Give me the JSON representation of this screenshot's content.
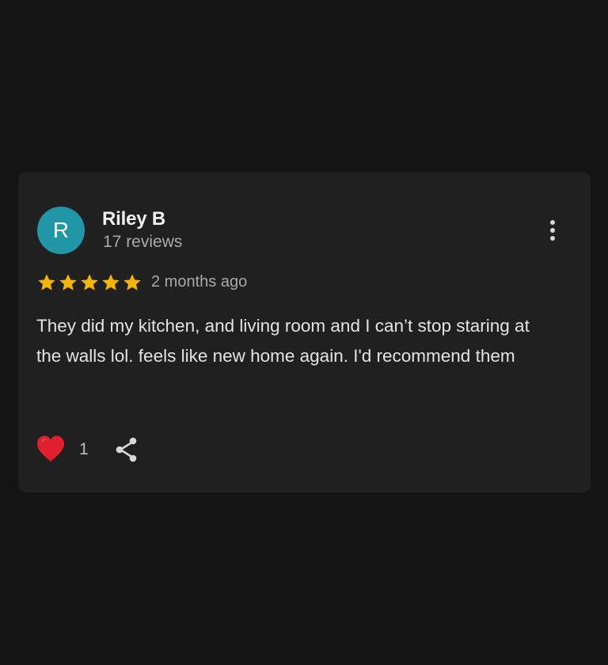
{
  "review": {
    "author_initial": "R",
    "author_name": "Riley B",
    "review_count": "17 reviews",
    "rating": 5,
    "rating_max": 5,
    "date": "2 months ago",
    "text": "They did my kitchen, and living room and I can’t stop staring at the walls lol. feels like new home again. I'd recommend them",
    "like_count": "1"
  },
  "icons": {
    "more": "more-vert-icon",
    "star": "star-icon",
    "like": "heart-icon",
    "share": "share-icon"
  },
  "colors": {
    "page_background": "#141414",
    "card_background": "#202020",
    "avatar": "#2196a6",
    "star": "#f5b400",
    "heart": "#e0202f"
  }
}
